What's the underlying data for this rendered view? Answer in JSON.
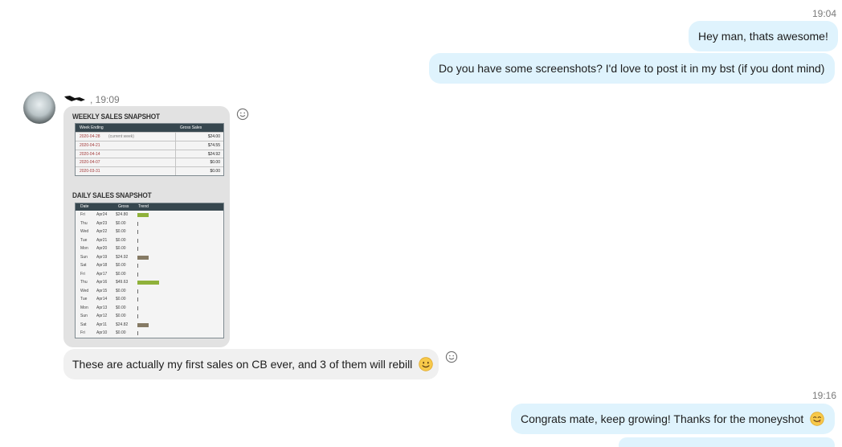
{
  "messages": {
    "time1": "19:04",
    "out1": "Hey man, thats awesome!",
    "out2": "Do you have some screenshots? I'd love to post it in my bst (if you dont mind)",
    "in_time": ", 19:09",
    "in_text": "These are actually my first sales on CB ever, and 3 of them will rebill",
    "time2": "19:16",
    "out3": "Congrats mate, keep growing! Thanks for the moneyshot"
  },
  "snapshot": {
    "weekly_title": "WEEKLY SALES SNAPSHOT",
    "weekly_headers": [
      "Week Ending",
      "Gross Sales"
    ],
    "weekly_rows": [
      {
        "date": "2020-04-28",
        "note": "(current week)",
        "value": "$24.00"
      },
      {
        "date": "2020-04-21",
        "note": "",
        "value": "$74.55"
      },
      {
        "date": "2020-04-14",
        "note": "",
        "value": "$24.92"
      },
      {
        "date": "2020-04-07",
        "note": "",
        "value": "$0.00"
      },
      {
        "date": "2020-03-31",
        "note": "",
        "value": "$0.00"
      }
    ],
    "daily_title": "DAILY SALES SNAPSHOT",
    "daily_headers": [
      "Date",
      "Gross",
      "Trend"
    ],
    "daily_rows": [
      {
        "day": "Fri",
        "date": "Apr24",
        "gross": "$24.80",
        "trend": 0.5,
        "color": "#8fb13a"
      },
      {
        "day": "Thu",
        "date": "Apr23",
        "gross": "$0.00",
        "trend": 0,
        "color": "#8fb13a"
      },
      {
        "day": "Wed",
        "date": "Apr22",
        "gross": "$0.00",
        "trend": 0,
        "color": "#8fb13a"
      },
      {
        "day": "Tue",
        "date": "Apr21",
        "gross": "$0.00",
        "trend": 0,
        "color": "#8fb13a"
      },
      {
        "day": "Mon",
        "date": "Apr20",
        "gross": "$0.00",
        "trend": 0,
        "color": "#8fb13a"
      },
      {
        "day": "Sun",
        "date": "Apr19",
        "gross": "$24.92",
        "trend": 0.5,
        "color": "#857a64"
      },
      {
        "day": "Sat",
        "date": "Apr18",
        "gross": "$0.00",
        "trend": 0,
        "color": "#857a64"
      },
      {
        "day": "Fri",
        "date": "Apr17",
        "gross": "$0.00",
        "trend": 0,
        "color": "#857a64"
      },
      {
        "day": "Thu",
        "date": "Apr16",
        "gross": "$49.63",
        "trend": 1.0,
        "color": "#8fb13a"
      },
      {
        "day": "Wed",
        "date": "Apr15",
        "gross": "$0.00",
        "trend": 0,
        "color": "#8fb13a"
      },
      {
        "day": "Tue",
        "date": "Apr14",
        "gross": "$0.00",
        "trend": 0,
        "color": "#8fb13a"
      },
      {
        "day": "Mon",
        "date": "Apr13",
        "gross": "$0.00",
        "trend": 0,
        "color": "#8fb13a"
      },
      {
        "day": "Sun",
        "date": "Apr12",
        "gross": "$0.00",
        "trend": 0,
        "color": "#8fb13a"
      },
      {
        "day": "Sat",
        "date": "Apr11",
        "gross": "$24.82",
        "trend": 0.5,
        "color": "#857a64"
      },
      {
        "day": "Fri",
        "date": "Apr10",
        "gross": "$0.00",
        "trend": 0,
        "color": "#857a64"
      }
    ]
  },
  "icons": {
    "reaction": "smiley-outline-icon",
    "emoji_smile": "smile-emoji-icon",
    "emoji_yum": "yum-emoji-icon"
  },
  "colors": {
    "bubble_out": "#dff3fd",
    "bubble_in": "#f0f0f0",
    "table_header": "#37474f"
  }
}
